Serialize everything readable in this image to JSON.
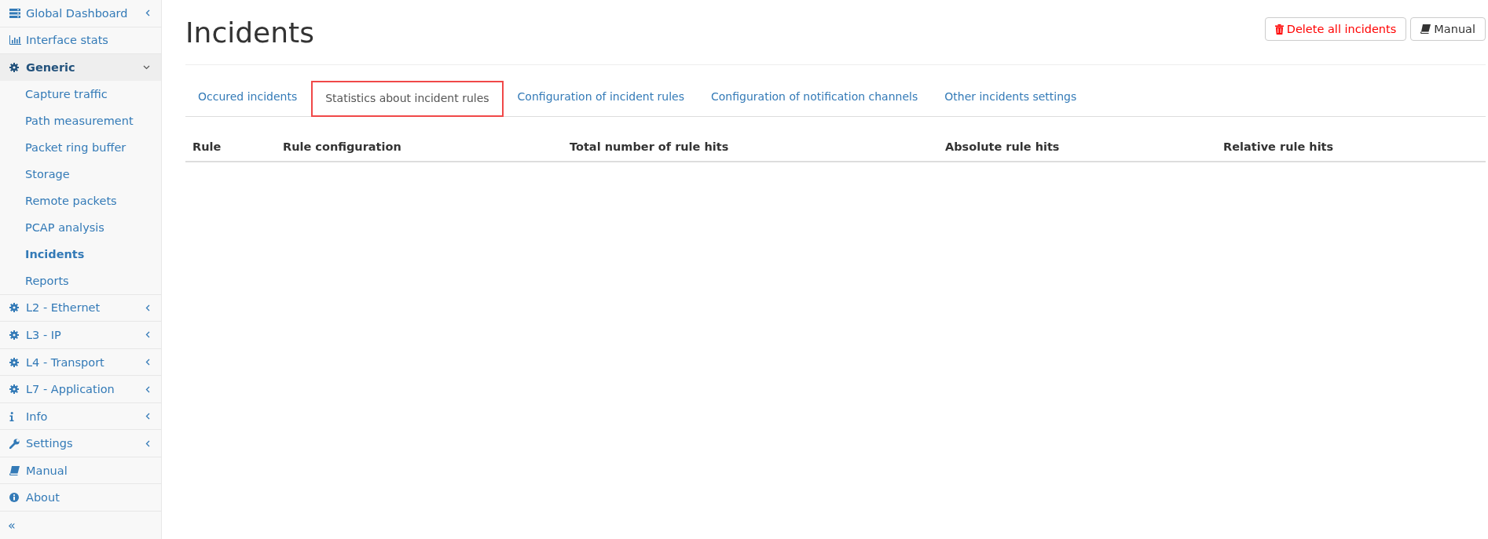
{
  "sidebar": {
    "items": [
      {
        "label": "Global Dashboard",
        "kind": "server",
        "expandable": true,
        "expanded": false
      },
      {
        "label": "Interface stats",
        "kind": "chart",
        "expandable": false,
        "expanded": false
      },
      {
        "label": "Generic",
        "kind": "gear",
        "expandable": true,
        "expanded": true,
        "children": [
          {
            "label": "Capture traffic",
            "selected": false
          },
          {
            "label": "Path measurement",
            "selected": false
          },
          {
            "label": "Packet ring buffer",
            "selected": false
          },
          {
            "label": "Storage",
            "selected": false
          },
          {
            "label": "Remote packets",
            "selected": false
          },
          {
            "label": "PCAP analysis",
            "selected": false
          },
          {
            "label": "Incidents",
            "selected": true
          },
          {
            "label": "Reports",
            "selected": false
          }
        ]
      },
      {
        "label": "L2 - Ethernet",
        "kind": "gear",
        "expandable": true,
        "expanded": false
      },
      {
        "label": "L3 - IP",
        "kind": "gear",
        "expandable": true,
        "expanded": false
      },
      {
        "label": "L4 - Transport",
        "kind": "gear",
        "expandable": true,
        "expanded": false
      },
      {
        "label": "L7 - Application",
        "kind": "gear",
        "expandable": true,
        "expanded": false
      },
      {
        "label": "Info",
        "kind": "info",
        "expandable": true,
        "expanded": false
      },
      {
        "label": "Settings",
        "kind": "wrench",
        "expandable": true,
        "expanded": false
      },
      {
        "label": "Manual",
        "kind": "book",
        "expandable": false,
        "expanded": false
      },
      {
        "label": "About",
        "kind": "info-circle",
        "expandable": false,
        "expanded": false
      }
    ],
    "collapse": "«"
  },
  "page": {
    "title": "Incidents",
    "buttons": [
      {
        "label": "Delete all incidents",
        "kind": "danger"
      },
      {
        "label": "Manual",
        "kind": "book"
      }
    ]
  },
  "tabs": [
    {
      "label": "Occured incidents",
      "selected": false
    },
    {
      "label": "Statistics about incident rules",
      "selected": true
    },
    {
      "label": "Configuration of incident rules",
      "selected": false
    },
    {
      "label": "Configuration of notification channels",
      "selected": false
    },
    {
      "label": "Other incidents settings",
      "selected": false
    }
  ],
  "table": {
    "columns": [
      "Rule",
      "Rule configuration",
      "Total number of rule hits",
      "Absolute rule hits",
      "Relative rule hits"
    ]
  }
}
